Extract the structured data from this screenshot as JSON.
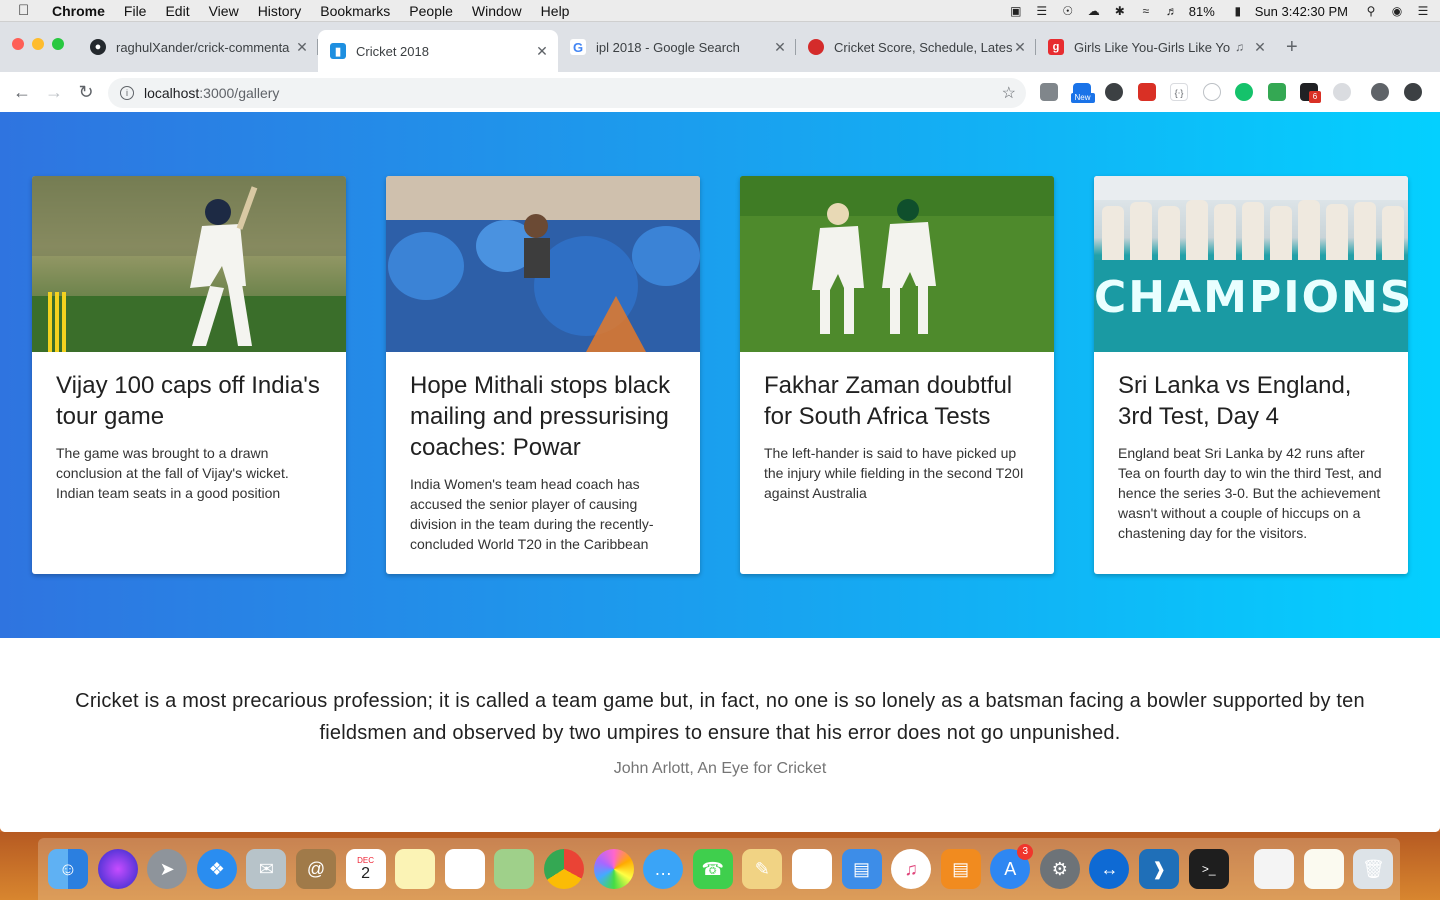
{
  "menubar": {
    "app_name": "Chrome",
    "menus": [
      "File",
      "Edit",
      "View",
      "History",
      "Bookmarks",
      "People",
      "Window",
      "Help"
    ],
    "battery": "81%",
    "clock": "Sun 3:42:30 PM"
  },
  "tabs": [
    {
      "title": "raghulXander/crick-commenta",
      "icon": "github-icon",
      "active": false
    },
    {
      "title": "Cricket 2018",
      "icon": "cricket-favicon",
      "active": true
    },
    {
      "title": "ipl 2018 - Google Search",
      "icon": "google-icon",
      "active": false
    },
    {
      "title": "Cricket Score, Schedule, Lates",
      "icon": "cricbuzz-icon",
      "active": false
    },
    {
      "title": "Girls Like You-Girls Like Yo",
      "icon": "gaana-icon",
      "active": false
    }
  ],
  "address_bar": {
    "host": "localhost",
    "path": ":3000/gallery"
  },
  "cards": [
    {
      "title": "Vijay 100 caps off India's tour game",
      "description": "The game was brought to a drawn conclusion at the fall of Vijay's wicket. Indian team seats in a good position"
    },
    {
      "title": "Hope Mithali stops black mailing and pressurising coaches: Powar",
      "description": "India Women's team head coach has accused the senior player of causing division in the team during the recently-concluded World T20 in the Caribbean"
    },
    {
      "title": "Fakhar Zaman doubtful for South Africa Tests",
      "description": "The left-hander is said to have picked up the injury while fielding in the second T20I against Australia"
    },
    {
      "title": "Sri Lanka vs England, 3rd Test, Day 4",
      "description": "England beat Sri Lanka by 42 runs after Tea on fourth day to win the third Test, and hence the series 3-0. But the achievement wasn't without a couple of hiccups on a chastening day for the visitors.",
      "image_text": "CHAMPIONS"
    }
  ],
  "quote": {
    "text": "Cricket is a most precarious profession; it is called a team game but, in fact, no one is so lonely as a batsman facing a bowler supported by ten fieldsmen and observed by two umpires to ensure that his error does not go unpunished.",
    "cite": "John Arlott, An Eye for Cricket"
  },
  "dock": {
    "calendar_month": "DEC",
    "calendar_day": "2",
    "appstore_badge": "3"
  },
  "extensions": {
    "new_badge": "New",
    "count_badge": "6"
  }
}
